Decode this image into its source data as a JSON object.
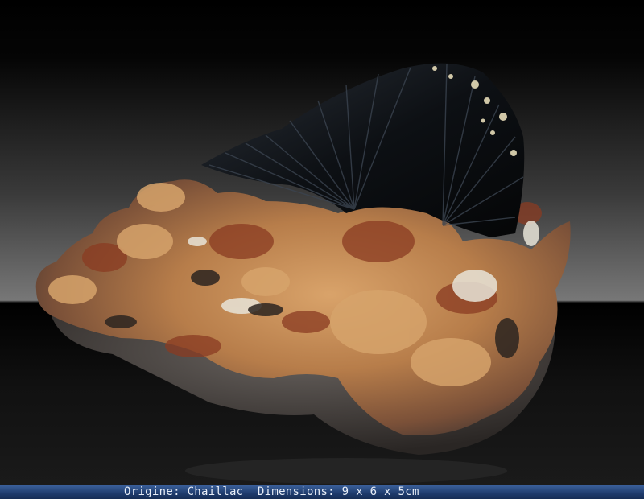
{
  "caption": {
    "origin_label": "Origine:",
    "origin_value": "Chaillac",
    "dimensions_label": "Dimensions:",
    "dimensions_value": "9 x 6 x 5cm"
  },
  "colors": {
    "background_top": "#000000",
    "background_mid": "#6e6e6e",
    "matrix_ochre": "#c08a52",
    "matrix_rust": "#8a3b22",
    "crystal_black": "#0d1014",
    "caption_bar": "#1e3b6c",
    "caption_text": "#e8eef8"
  }
}
